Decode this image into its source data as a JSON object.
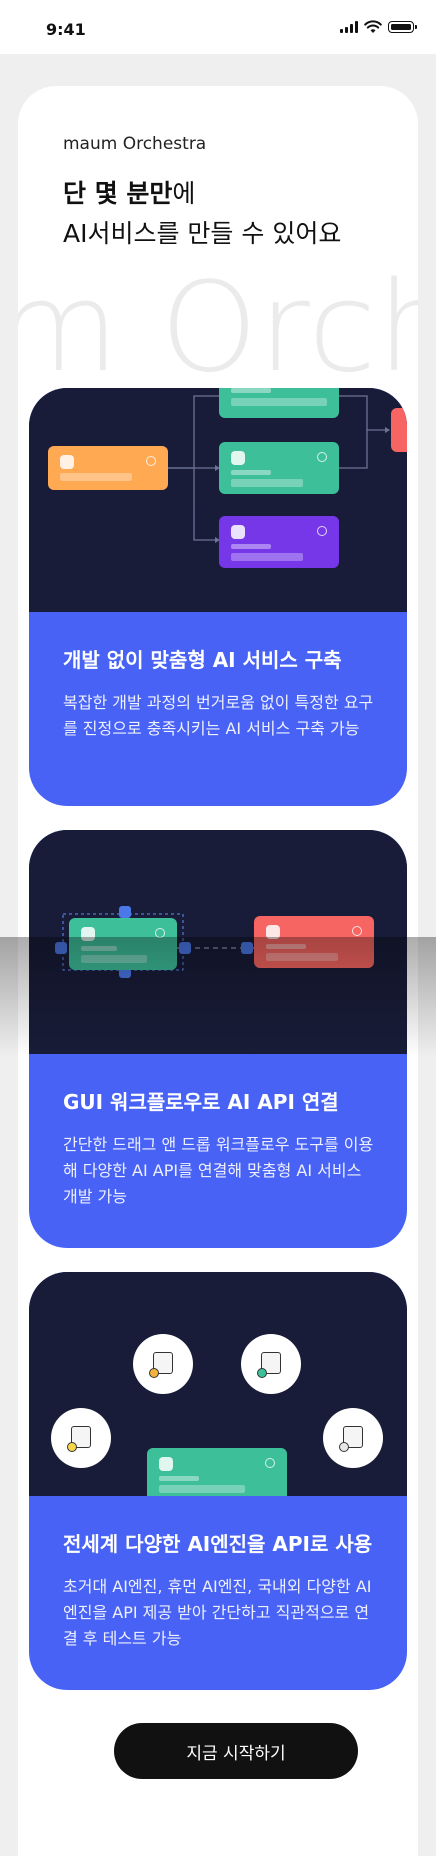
{
  "status_bar": {
    "time": "9:41"
  },
  "brand": "maum Orchestra",
  "headline": {
    "bold": "단 몇 분만",
    "tail": "에",
    "line2": "AI서비스를 만들 수 있어요"
  },
  "watermark": "m Orche",
  "features": [
    {
      "title": "개발 없이 맞춤형 AI 서비스 구축",
      "description": "복잡한 개발 과정의 번거로움 없이 특정한 요구를 진정으로 충족시키는 AI 서비스 구축 가능"
    },
    {
      "title": "GUI 워크플로우로 AI API 연결",
      "description": "간단한 드래그 앤 드롭 워크플로우 도구를 이용해 다양한 AI API를 연결해 맞춤형 AI 서비스 개발 가능"
    },
    {
      "title": "전세계 다양한 AI엔진을 API로 사용",
      "description": "초거대 AI엔진, 휴먼 AI엔진, 국내외 다양한 AI 엔진을 API 제공 받아 간단하고 직관적으로 연결 후 테스트 가능"
    }
  ],
  "cta_label": "지금 시작하기",
  "colors": {
    "feature_bg": "#4762f5",
    "visual_bg": "#181c38",
    "node_orange": "#ffa953",
    "node_green": "#3dbf9a",
    "node_purple": "#7637e8",
    "node_red": "#f66561",
    "cta_bg": "#111111"
  },
  "icons": [
    "signal-icon",
    "wifi-icon",
    "battery-icon",
    "check-circle-icon",
    "node-icon",
    "engine-icon"
  ]
}
